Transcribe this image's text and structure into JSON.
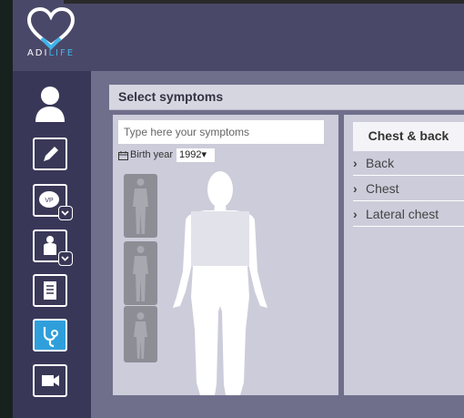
{
  "brand": {
    "name_part1": "ADI",
    "name_part2": "LIFE",
    "accent": "#3fb5e8"
  },
  "sidebar": {
    "items": [
      {
        "name": "profile",
        "icon": "user-icon"
      },
      {
        "name": "edit",
        "icon": "pencil-icon"
      },
      {
        "name": "vitals",
        "icon": "vp-chat-icon",
        "badge": "chevron-down-icon"
      },
      {
        "name": "body",
        "icon": "body-icon",
        "badge": "chevron-down-icon"
      },
      {
        "name": "list",
        "icon": "list-icon"
      },
      {
        "name": "symptoms",
        "icon": "stethoscope-icon",
        "active": true
      },
      {
        "name": "video",
        "icon": "video-camera-icon"
      }
    ]
  },
  "panel": {
    "title": "Select symptoms",
    "search_placeholder": "Type here your symptoms",
    "birth_label": "Birth year",
    "birth_year": "1992"
  },
  "categories": {
    "title": "Chest & back",
    "items": [
      "Back",
      "Chest",
      "Lateral chest"
    ]
  }
}
